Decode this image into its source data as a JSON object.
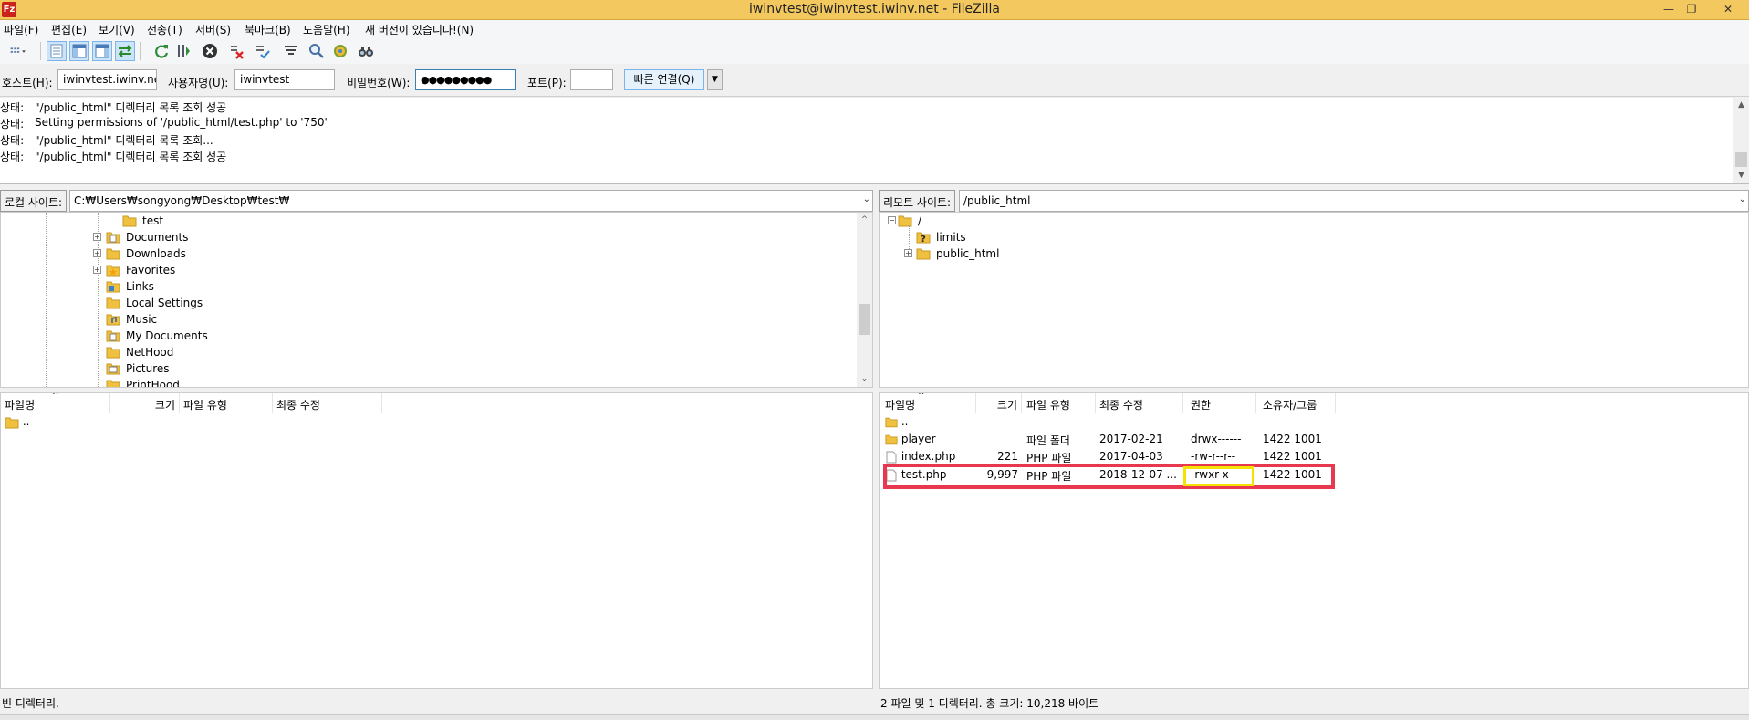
{
  "window": {
    "title": "iwinvtest@iwinvtest.iwinv.net - FileZilla",
    "app_icon": "Fz"
  },
  "menu": [
    "파일(F)",
    "편집(E)",
    "보기(V)",
    "전송(T)",
    "서버(S)",
    "북마크(B)",
    "도움말(H)",
    "새 버전이 있습니다!(N)"
  ],
  "quickconnect": {
    "host_label": "호스트(H):",
    "host_value": "iwinvtest.iwinv.net",
    "user_label": "사용자명(U):",
    "user_value": "iwinvtest",
    "pass_label": "비밀번호(W):",
    "pass_value": "●●●●●●●●●",
    "port_label": "포트(P):",
    "port_value": "",
    "connect_label": "빠른 연결(Q)"
  },
  "log": [
    {
      "label": "상태:",
      "message": "\"/public_html\" 디렉터리 목록 조회 성공"
    },
    {
      "label": "상태:",
      "message": "Setting permissions of '/public_html/test.php' to '750'"
    },
    {
      "label": "상태:",
      "message": "\"/public_html\" 디렉터리 목록 조회..."
    },
    {
      "label": "상태:",
      "message": "\"/public_html\" 디렉터리 목록 조회 성공"
    }
  ],
  "local": {
    "site_label": "로컬 사이트:",
    "path": "C:₩Users₩songyong₩Desktop₩test₩",
    "tree": [
      {
        "name": "test",
        "icon": "folder-icon"
      },
      {
        "name": "Documents",
        "icon": "documents-icon"
      },
      {
        "name": "Downloads",
        "icon": "folder-icon"
      },
      {
        "name": "Favorites",
        "icon": "favorites-icon"
      },
      {
        "name": "Links",
        "icon": "links-icon"
      },
      {
        "name": "Local Settings",
        "icon": "folder-icon"
      },
      {
        "name": "Music",
        "icon": "music-icon"
      },
      {
        "name": "My Documents",
        "icon": "documents-icon"
      },
      {
        "name": "NetHood",
        "icon": "folder-icon"
      },
      {
        "name": "Pictures",
        "icon": "pictures-icon"
      },
      {
        "name": "PrintHood",
        "icon": "folder-icon"
      }
    ],
    "columns": [
      "파일명",
      "크기",
      "파일 유형",
      "최종 수정"
    ],
    "files": [
      {
        "name": ".."
      }
    ],
    "status": "빈 디렉터리."
  },
  "remote": {
    "site_label": "리모트 사이트:",
    "path": "/public_html",
    "tree": [
      {
        "name": "/",
        "icon": "folder-icon"
      },
      {
        "name": "limits",
        "icon": "unknown-folder-icon"
      },
      {
        "name": "public_html",
        "icon": "folder-icon"
      }
    ],
    "columns": [
      "파일명",
      "크기",
      "파일 유형",
      "최종 수정",
      "권한",
      "소유자/그룹"
    ],
    "files": [
      {
        "name": "..",
        "size": "",
        "type": "",
        "modified": "",
        "perms": "",
        "owner": "",
        "icon": "folder-icon"
      },
      {
        "name": "player",
        "size": "",
        "type": "파일 폴더",
        "modified": "2017-02-21",
        "perms": "drwx------",
        "owner": "1422 1001",
        "icon": "folder-icon"
      },
      {
        "name": "index.php",
        "size": "221",
        "type": "PHP 파일",
        "modified": "2017-04-03",
        "perms": "-rw-r--r--",
        "owner": "1422 1001",
        "icon": "file-icon"
      },
      {
        "name": "test.php",
        "size": "9,997",
        "type": "PHP 파일",
        "modified": "2018-12-07 ...",
        "perms": "-rwxr-x---",
        "owner": "1422 1001",
        "icon": "file-icon"
      }
    ],
    "status": "2 파일 및 1 디렉터리. 총 크기: 10,218 바이트"
  },
  "colors": {
    "titlebar": "#f2c85f",
    "highlight_red": "#e8384f",
    "highlight_yellow": "#f4e300",
    "folder": "#f0c040"
  }
}
